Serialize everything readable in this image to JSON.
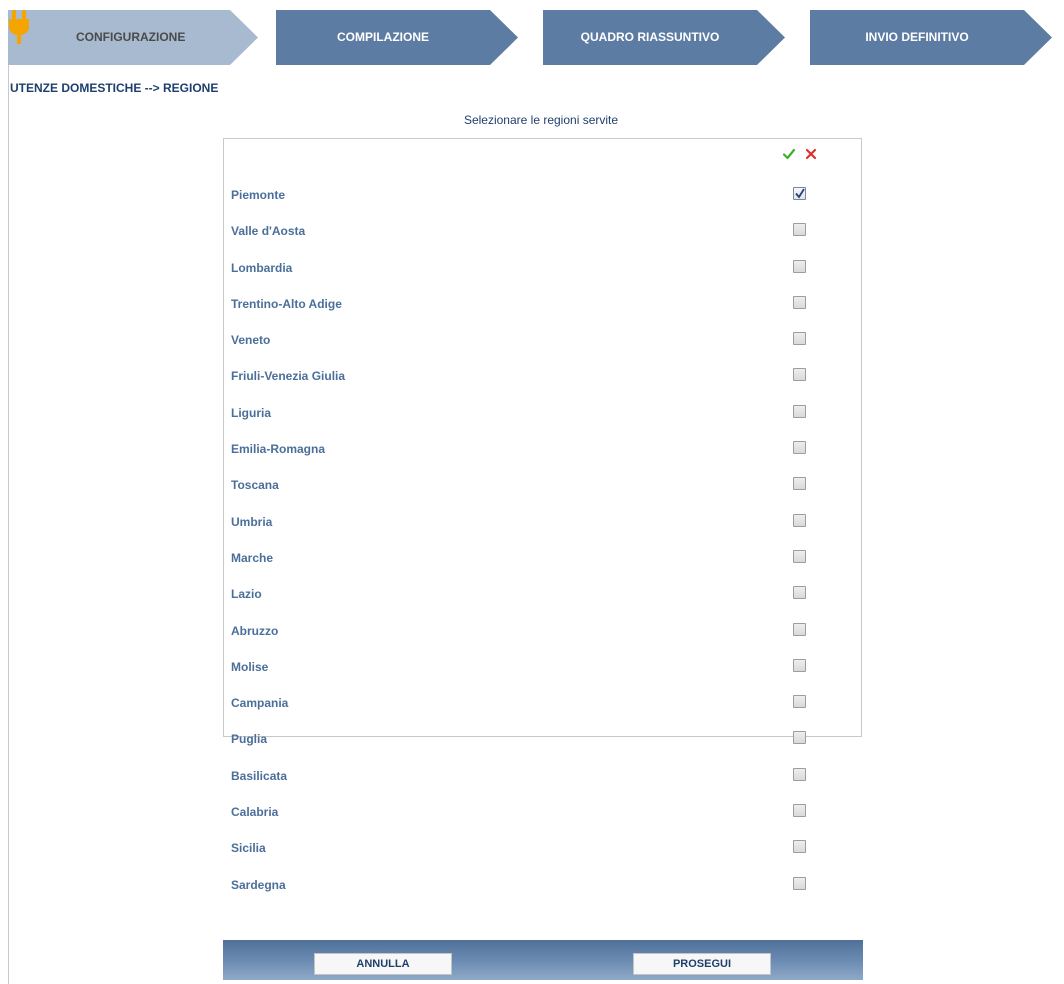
{
  "steps": [
    {
      "label": "CONFIGURAZIONE",
      "state": "current",
      "color": "#a8bad0"
    },
    {
      "label": "COMPILAZIONE",
      "state": "pending",
      "color": "#5c7ca3"
    },
    {
      "label": "QUADRO RIASSUNTIVO",
      "state": "pending",
      "color": "#5c7ca3"
    },
    {
      "label": "INVIO DEFINITIVO",
      "state": "pending",
      "color": "#5c7ca3"
    }
  ],
  "breadcrumb": "UTENZE DOMESTICHE --> REGIONE",
  "subtitle": "Selezionare le regioni servite",
  "regions": [
    {
      "label": "Piemonte",
      "checked": true
    },
    {
      "label": "Valle d'Aosta",
      "checked": false
    },
    {
      "label": "Lombardia",
      "checked": false
    },
    {
      "label": "Trentino-Alto Adige",
      "checked": false
    },
    {
      "label": "Veneto",
      "checked": false
    },
    {
      "label": "Friuli-Venezia Giulia",
      "checked": false
    },
    {
      "label": "Liguria",
      "checked": false
    },
    {
      "label": "Emilia-Romagna",
      "checked": false
    },
    {
      "label": "Toscana",
      "checked": false
    },
    {
      "label": "Umbria",
      "checked": false
    },
    {
      "label": "Marche",
      "checked": false
    },
    {
      "label": "Lazio",
      "checked": false
    },
    {
      "label": "Abruzzo",
      "checked": false
    },
    {
      "label": "Molise",
      "checked": false
    },
    {
      "label": "Campania",
      "checked": false
    },
    {
      "label": "Puglia",
      "checked": false
    },
    {
      "label": "Basilicata",
      "checked": false
    },
    {
      "label": "Calabria",
      "checked": false
    },
    {
      "label": "Sicilia",
      "checked": false
    },
    {
      "label": "Sardegna",
      "checked": false
    }
  ],
  "buttons": {
    "cancel": "ANNULLA",
    "next": "PROSEGUI"
  },
  "icons": {
    "select_all": "checkmark-icon",
    "deselect_all": "cross-icon",
    "step1": "plug-icon"
  },
  "colors": {
    "accent_green": "#3fae2a",
    "accent_red": "#e0302b",
    "label_blue": "#4b6f99",
    "title_blue": "#1e3f6e"
  }
}
